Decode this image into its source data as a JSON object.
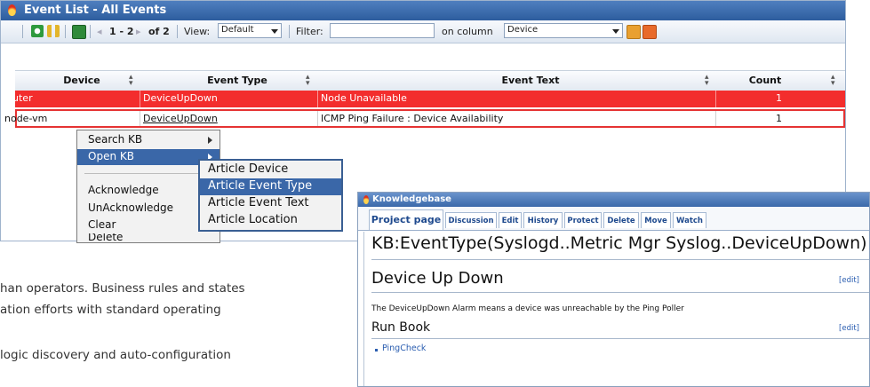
{
  "event_list": {
    "title": "Event List - All Events",
    "toolbar": {
      "paging_range": "1 - 2",
      "paging_of": "of 2",
      "view_label": "View:",
      "view_value": "Default",
      "filter_label": "Filter:",
      "filter_value": "",
      "on_column_label": "on column",
      "column_value": "Device"
    },
    "columns": [
      "Device",
      "Event Type",
      "Event Text",
      "Count"
    ],
    "rows": [
      {
        "device": "router",
        "event_type": "DeviceUpDown",
        "event_text": "Node Unavailable",
        "count": "1"
      },
      {
        "device": "node-vm",
        "event_type": "DeviceUpDown",
        "event_text": "ICMP Ping Failure : Device Availability",
        "count": "1"
      }
    ],
    "row_colors": {
      "critical": "#f32d2d"
    }
  },
  "context_menu": {
    "items": [
      "Search KB",
      "Open KB",
      "Acknowledge",
      "UnAcknowledge",
      "Clear",
      "Delete"
    ],
    "selected": "Open KB"
  },
  "submenu": {
    "items": [
      "Article Device",
      "Article Event Type",
      "Article Event Text",
      "Article Location"
    ],
    "selected": "Article Event Type"
  },
  "background_text": {
    "line1": "han operators. Business rules and states",
    "line2": "ation  efforts  with  standard  operating",
    "line3": "logic discovery and auto-configuration"
  },
  "knowledgebase": {
    "title": "Knowledgebase",
    "tabs": [
      "Project page",
      "Discussion",
      "Edit",
      "History",
      "Protect",
      "Delete",
      "Move",
      "Watch"
    ],
    "active_tab": "Project page",
    "page_title": "KB:EventType(Syslogd..Metric Mgr Syslog..DeviceUpDown)",
    "section1_heading": "Device Up Down",
    "edit_label": "[edit]",
    "section1_text": "The DeviceUpDown Alarm means a device was unreachable by the Ping Poller",
    "section2_heading": "Run Book",
    "bullet1": "PingCheck"
  },
  "colors": {
    "title_bar": "#2d5d9e",
    "menu_highlight": "#3a67a8",
    "link": "#2a5db0"
  }
}
